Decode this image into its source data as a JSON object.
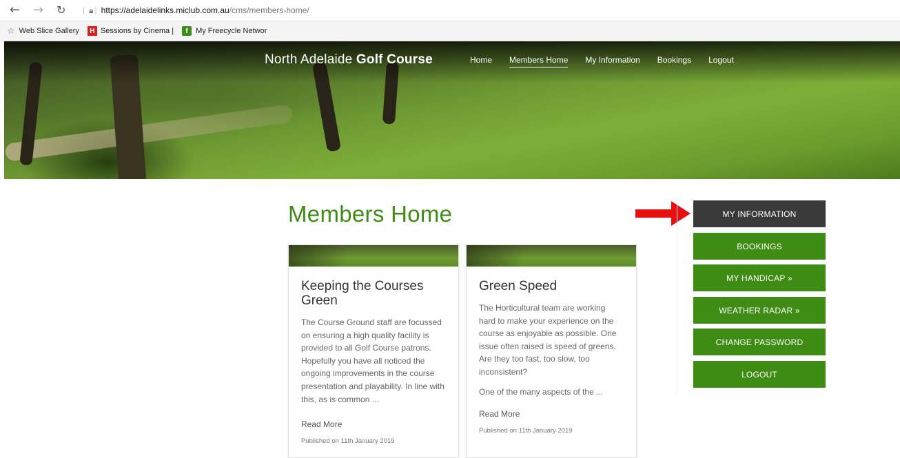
{
  "browser": {
    "url_host": "https://adelaidelinks.miclub.com.au",
    "url_path": "/cms/members-home/",
    "favorites": [
      {
        "label": "Web Slice Gallery"
      },
      {
        "label": "Sessions by Cinema |"
      },
      {
        "label": "My Freecycle Networ"
      }
    ],
    "fav_icon_h": "H",
    "fav_icon_f": "f"
  },
  "header": {
    "brand_light": "North Adelaide ",
    "brand_bold": "Golf Course",
    "menu": [
      "Home",
      "Members Home",
      "My Information",
      "Bookings",
      "Logout"
    ],
    "active_menu": "Members Home"
  },
  "main": {
    "title": "Members Home",
    "articles": [
      {
        "title": "Keeping the Courses Green",
        "text": "The Course Ground staff are focussed on ensuring a high quality facility is provided to all Golf Course patrons. Hopefully you have all noticed the ongoing improvements in the course presentation and playability. In line with this, as is common ...",
        "extra": "",
        "read_more": "Read More",
        "published": "Published on 11th January 2019"
      },
      {
        "title": "Green Speed",
        "text": "The Horticultural team are working hard to make your experience on the course as enjoyable as possible. One issue often raised is speed of greens. Are they too fast, too slow, too inconsistent?",
        "extra": "One of the many aspects of the ...",
        "read_more": "Read More",
        "published": "Published on 11th January 2019"
      }
    ]
  },
  "sidebar": {
    "buttons": [
      "MY INFORMATION",
      "BOOKINGS",
      "MY HANDICAP »",
      "WEATHER RADAR »",
      "CHANGE PASSWORD",
      "LOGOUT"
    ]
  },
  "colors": {
    "accent_green": "#3f8c14",
    "dark_button": "#3a3a3a",
    "arrow_red": "#e8100f"
  }
}
